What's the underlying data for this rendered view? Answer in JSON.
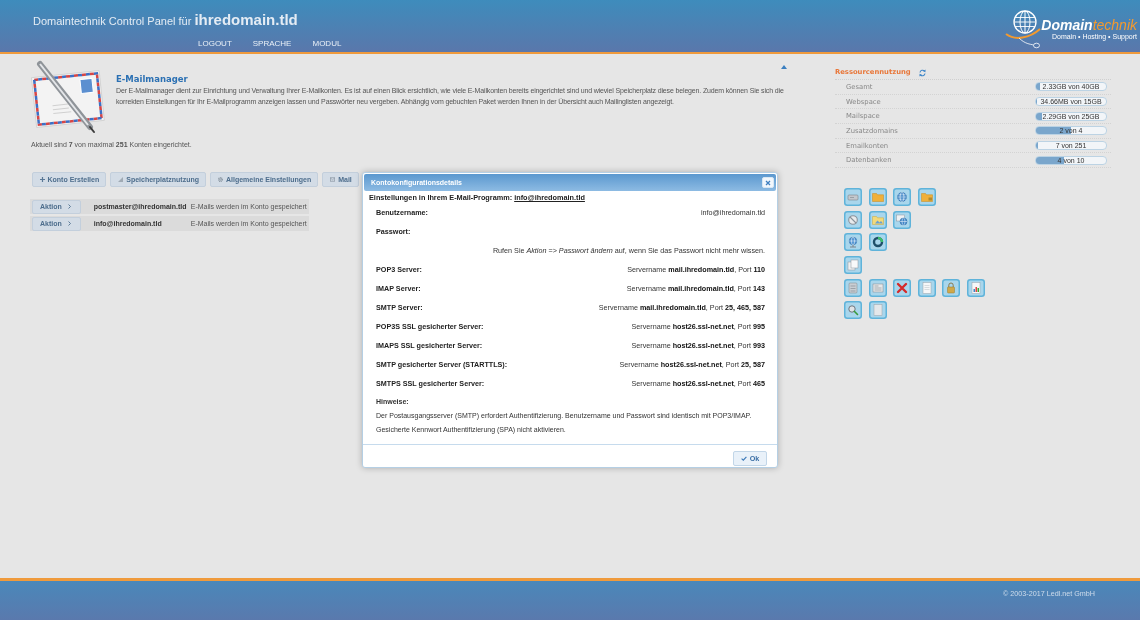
{
  "header": {
    "title": "Domaintechnik Control Panel für **ihredomain.tld**",
    "nav": [
      "LOGOUT",
      "SPRACHE",
      "MODUL"
    ],
    "logo": {
      "name": "**Domain**technik",
      "tagline": "Domain • Hosting • Support"
    }
  },
  "module": {
    "title": "E-Mailmanager",
    "description": "Der E-Mailmanager dient zur Einrichtung und Verwaltung Ihrer E-Mailkonten. Es ist auf einen Blick ersichtlich, wie viele E-Mailkonten bereits eingerichtet sind und wieviel Speicherplatz diese belegen. Zudem können Sie sich die korrekten Einstellungen für Ihr E-Mailprogramm anzeigen lassen und Passwörter neu vergeben. Abhängig vom gebuchten Paket werden Ihnen in der Übersicht auch Mailinglisten angezeigt.",
    "summary": "Aktuell sind **7** von maximal **251** Konten eingerichtet.",
    "buttons": [
      {
        "kind": "add",
        "label": "Konto Erstellen"
      },
      {
        "kind": "usage",
        "label": "Speicherplatznutzung"
      },
      {
        "kind": "settings",
        "label": "Allgemeine Einstellungen"
      },
      {
        "kind": "mail",
        "label": "Mail"
      }
    ]
  },
  "accounts": [
    {
      "action": "Aktion",
      "address": "postmaster@ihredomain.tld",
      "note": "E-Mails werden im Konto gespeichert"
    },
    {
      "action": "Aktion",
      "address": "info@ihredomain.tld",
      "note": "E-Mails werden im Konto gespeichert"
    }
  ],
  "resources": {
    "title": "Ressourcennutzung",
    "rows": [
      {
        "label": "Gesamt",
        "reading": "2.33GB von 40GB",
        "level": 0.058
      },
      {
        "label": "Webspace",
        "reading": "34.66MB von 15GB",
        "level": 0.0023
      },
      {
        "label": "Mailspace",
        "reading": "2.29GB von 25GB",
        "level": 0.092
      },
      {
        "label": "Zusatzdomains",
        "reading": "2 von 4",
        "level": 0.5
      },
      {
        "label": "Emailkonten",
        "reading": "7 von 251",
        "level": 0.028
      },
      {
        "label": "Datenbanken",
        "reading": "4 von 10",
        "level": 0.4
      }
    ]
  },
  "dialog": {
    "title": "Kontokonfigurationsdetails",
    "intro": "Einstellungen in Ihrem E-Mail-Programm:",
    "intro_link": "info@ihredomain.tld",
    "rows": [
      {
        "kind": "field",
        "label": "Benutzername:",
        "value": "info@ihredomain.tld"
      },
      {
        "kind": "field",
        "label": "Passwort:"
      },
      {
        "kind": "hint",
        "text": "Rufen Sie *Aktion* => *Passwort ändern* auf, wenn Sie das Passwort nicht mehr wissen."
      },
      {
        "kind": "field",
        "label": "POP3 Server:",
        "value": "Servername **mail.ihredomain.tld**, Port **110**"
      },
      {
        "kind": "field",
        "label": "IMAP Server:",
        "value": "Servername **mail.ihredomain.tld**, Port **143**"
      },
      {
        "kind": "field",
        "label": "SMTP Server:",
        "value": "Servername **mail.ihredomain.tld**, Port **25, 465, 587**"
      },
      {
        "kind": "field",
        "label": "POP3S SSL gesicherter Server:",
        "value": "Servername **host26.ssl-net.net**, Port **995**"
      },
      {
        "kind": "field",
        "label": "IMAPS SSL gesicherter Server:",
        "value": "Servername **host26.ssl-net.net**, Port **993**"
      },
      {
        "kind": "field",
        "label": "SMTP gesicherter Server (STARTTLS):",
        "value": "Servername **host26.ssl-net.net**, Port **25, 587**"
      },
      {
        "kind": "field",
        "label": "SMTPS SSL gesicherter Server:",
        "value": "Servername **host26.ssl-net.net**, Port **465**"
      }
    ],
    "notes_title": "Hinweise:",
    "notes": [
      "Der Postausgangsserver (SMTP) erfordert Authentifizierung. Benutzername und Passwort sind identisch mit POP3/IMAP.",
      "Gesicherte Kennwort Authentifizierung (SPA) nicht aktivieren."
    ],
    "ok_button": "Ok"
  },
  "footer": {
    "copyright": "© 2003-2017 Ledl.net GmbH"
  }
}
